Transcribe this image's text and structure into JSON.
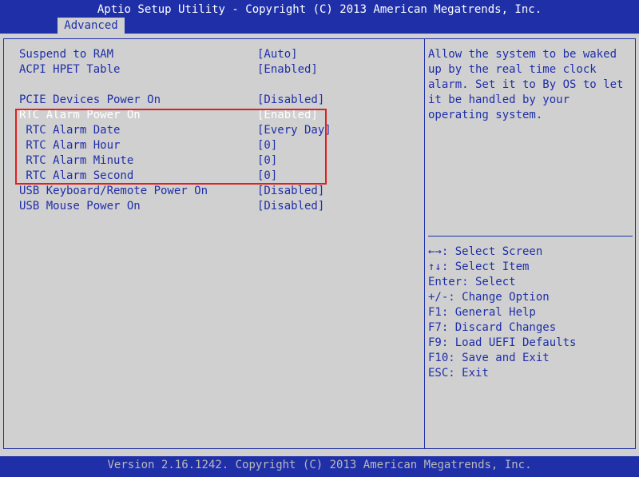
{
  "header": {
    "title": "Aptio Setup Utility - Copyright (C) 2013 American Megatrends, Inc."
  },
  "tabs": {
    "active": "Advanced"
  },
  "settings": [
    {
      "label": "Suspend to RAM",
      "value": "[Auto]"
    },
    {
      "label": "ACPI HPET Table",
      "value": "[Enabled]"
    },
    {
      "label": "PCIE Devices Power On",
      "value": "[Disabled]"
    },
    {
      "label": "RTC Alarm Power On",
      "value": "[Enabled]"
    },
    {
      "label": " RTC Alarm Date",
      "value": "[Every Day]"
    },
    {
      "label": " RTC Alarm Hour",
      "value": "[0]"
    },
    {
      "label": " RTC Alarm Minute",
      "value": "[0]"
    },
    {
      "label": " RTC Alarm Second",
      "value": "[0]"
    },
    {
      "label": "USB Keyboard/Remote Power On",
      "value": "[Disabled]"
    },
    {
      "label": "USB Mouse Power On",
      "value": "[Disabled]"
    }
  ],
  "help": {
    "text": "Allow the system to be waked\nup by the real time clock\nalarm. Set it to By OS to let\nit be handled by your\noperating system."
  },
  "keys": [
    "←→: Select Screen",
    "↑↓: Select Item",
    "Enter: Select",
    "+/-: Change Option",
    "F1: General Help",
    "F7: Discard Changes",
    "F9: Load UEFI Defaults",
    "F10: Save and Exit",
    "ESC: Exit"
  ],
  "footer": {
    "text": "Version 2.16.1242. Copyright (C) 2013 American Megatrends, Inc."
  },
  "colors": {
    "background": "#d0d0d0",
    "accent": "#1f2fa8",
    "selected_text": "#ffffff",
    "highlight_box": "#e02020"
  }
}
